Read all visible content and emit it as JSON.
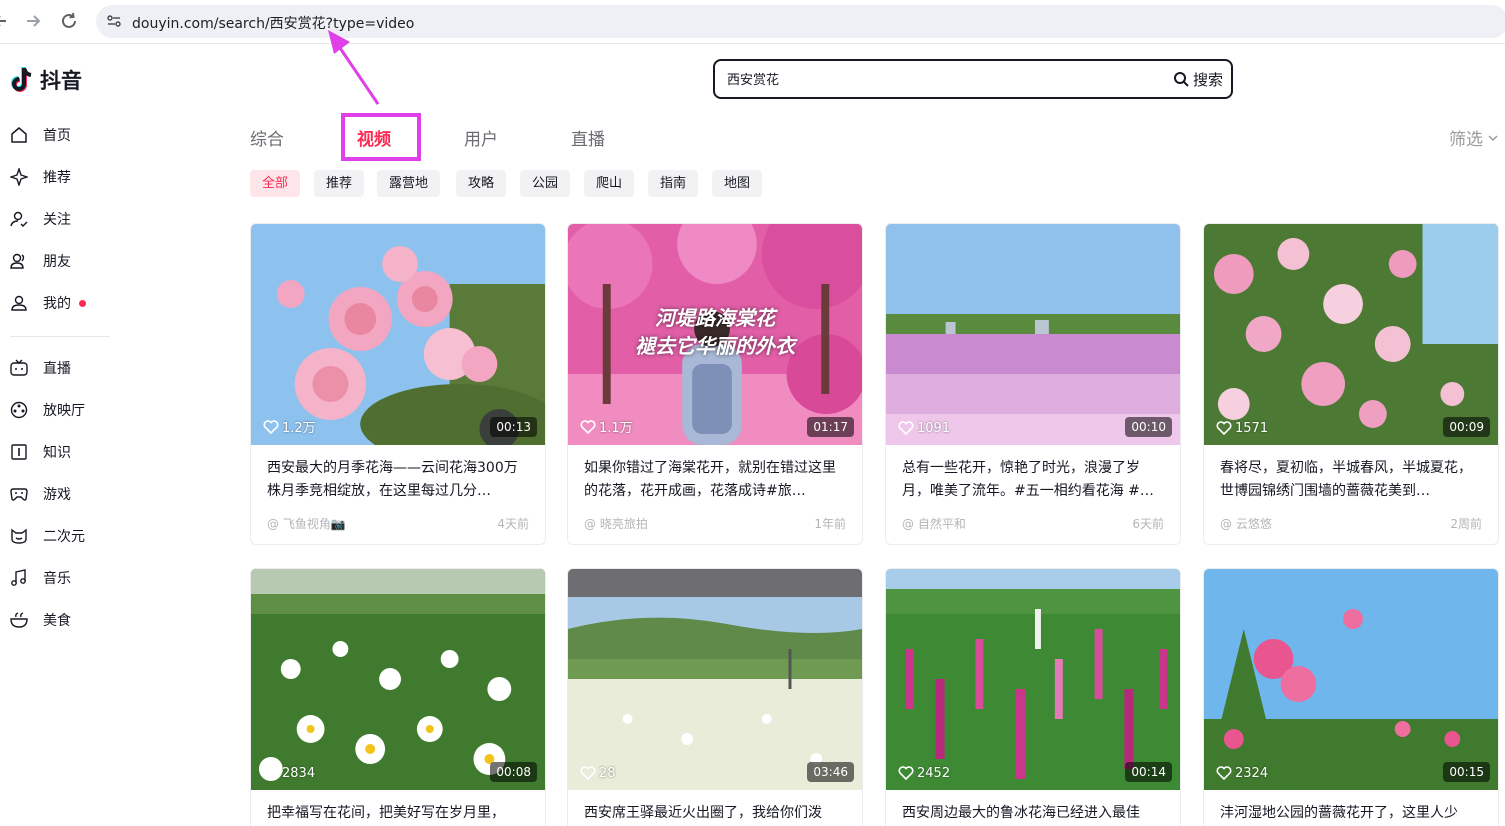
{
  "browser": {
    "back_icon": "back-arrow-icon",
    "forward_icon": "forward-arrow-icon",
    "reload_icon": "reload-icon",
    "url": "douyin.com/search/西安赏花?type=video"
  },
  "app": {
    "name": "抖音"
  },
  "sidebar": {
    "items": [
      {
        "label": "首页",
        "icon": "home-icon"
      },
      {
        "label": "推荐",
        "icon": "sparkle-icon"
      },
      {
        "label": "关注",
        "icon": "follow-icon"
      },
      {
        "label": "朋友",
        "icon": "friends-icon"
      },
      {
        "label": "我的",
        "icon": "user-icon"
      },
      {
        "label": "直播",
        "icon": "live-tv-icon"
      },
      {
        "label": "放映厅",
        "icon": "film-reel-icon"
      },
      {
        "label": "知识",
        "icon": "knowledge-icon"
      },
      {
        "label": "游戏",
        "icon": "gamepad-icon"
      },
      {
        "label": "二次元",
        "icon": "anime-icon"
      },
      {
        "label": "音乐",
        "icon": "music-note-icon"
      },
      {
        "label": "美食",
        "icon": "bowl-icon"
      }
    ]
  },
  "search": {
    "value": "西安赏花",
    "button_label": "搜索"
  },
  "tabs": [
    {
      "label": "综合"
    },
    {
      "label": "视频"
    },
    {
      "label": "用户"
    },
    {
      "label": "直播"
    }
  ],
  "filter_label": "筛选",
  "chips": [
    "全部",
    "推荐",
    "露营地",
    "攻略",
    "公园",
    "爬山",
    "指南",
    "地图"
  ],
  "colors": {
    "accent": "#fe2c55",
    "annotation": "#e040e8"
  },
  "videos": [
    {
      "likes": "1.2万",
      "duration": "00:13",
      "desc": "西安最大的月季花海——云间花海300万株月季竞相绽放，在这里每过几分…",
      "author": "@ 飞鱼视角📷",
      "time": "4天前"
    },
    {
      "likes": "1.1万",
      "duration": "01:17",
      "overlay_line1": "河堤路海棠花",
      "overlay_line2": "褪去它华丽的外衣",
      "desc": "如果你错过了海棠花开，就别在错过这里的花落，花开成画，花落成诗#旅…",
      "author": "@ 晓亮旅拍",
      "time": "1年前"
    },
    {
      "likes": "1091",
      "duration": "00:10",
      "desc": "总有一些花开，惊艳了时光，浪漫了岁月，唯美了流年。#五一相约看花海 #…",
      "author": "@ 自然平和",
      "time": "6天前"
    },
    {
      "likes": "1571",
      "duration": "00:09",
      "desc": "春将尽，夏初临，半城春风，半城夏花，世博园锦绣门围墙的蔷薇花美到…",
      "author": "@ 云悠悠",
      "time": "2周前"
    },
    {
      "likes": "2834",
      "duration": "00:08",
      "desc": "把幸福写在花间，把美好写在岁月里，"
    },
    {
      "likes": "28",
      "duration": "03:46",
      "desc": "西安席王驿最近火出圈了，我给你们泼"
    },
    {
      "likes": "2452",
      "duration": "00:14",
      "desc": "西安周边最大的鲁冰花海已经进入最佳"
    },
    {
      "likes": "2324",
      "duration": "00:15",
      "desc": "沣河湿地公园的蔷薇花开了，这里人少"
    }
  ]
}
